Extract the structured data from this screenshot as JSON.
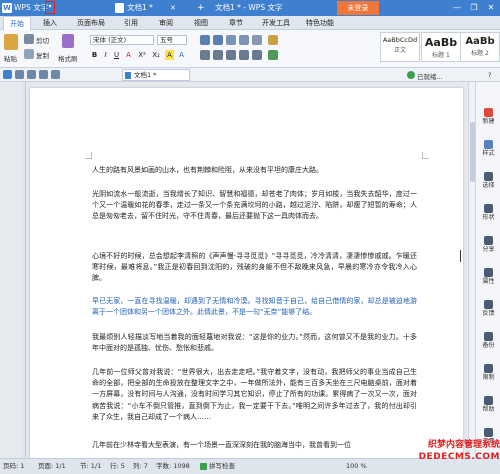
{
  "titlebar": {
    "app_menu": "WPS 文字",
    "dropdown_glyph": "▾",
    "doc_title": "文档1 *",
    "doc_close": "✕",
    "new_tab": "+",
    "app_title": "文档1 * - WPS 文字",
    "login": "未登录",
    "window_controls": [
      "—",
      "❐",
      "✕"
    ]
  },
  "ribbon_tabs": [
    "开始",
    "插入",
    "页面布局",
    "引用",
    "审阅",
    "视图",
    "章节",
    "开发工具",
    "特色功能"
  ],
  "ribbon": {
    "paste": "粘贴",
    "cut": "剪切",
    "copy": "复制",
    "format_painter": "格式刷",
    "font_name": "宋体 (正文)",
    "font_size": "五号",
    "font_buttons": [
      "B",
      "I",
      "U",
      "A",
      "X²",
      "X₂",
      "A",
      "A"
    ],
    "styles": [
      {
        "sample": "AaBbCcDd",
        "name": "正文"
      },
      {
        "sample": "AaBb",
        "name": "标题 1"
      },
      {
        "sample": "AaBb",
        "name": "标题 2"
      }
    ],
    "qa_status": "已就绪...",
    "help_glyph": "?"
  },
  "doc_tab": "文档1 *",
  "document": {
    "paragraphs": [
      {
        "text": "人生的路有风景如画的山水，也有荆棘和险阻，从来没有平坦的康庄大路。",
        "blue": false
      },
      {
        "text": "光阴如流水一般流逝，当我增长了知识、智慧和福德，却苍老了肉体；岁月如梭，当我失去韶华，度过一个又一个温暖如花的春季，走过一条又一个条充满坎坷的小路，越过泥泞、陷阱，却瘦了短暂的寿命；人总是匆匆老去，留不住时光，守不住青春，最后还要抛下这一具肉体而去。",
        "blue": false
      },
      {
        "text": "心境不好的时候，总会想起李清照的《声声慢·寻寻觅觅》“寻寻觅觅，冷冷清清，凄凄惨惨戚戚。乍暖还寒时候，最难将息。”我正是初春回到沈阳的，残破的身躯不但不敌晚来风急，早晨的寒冷亦令我冷入心脾。",
        "blue": false
      },
      {
        "text": "早已无家，一直在寻找温暖，却遇到了无情和冷漠。寻找知音于自己，给自己借情的家，却总是被迫地游离于一个团体和另一个团体之外。此情此景，不是一句“无奈”能够了结。",
        "blue": true
      },
      {
        "text": "我最烦别人轻描淡写地当着我的面轻蔑地对我说：“这是你的业力。”然而，这何曾又不是我的业力。十多年中面对的是孤独、忧伤、愁怅和悲戚。",
        "blue": false
      },
      {
        "text": "几年前一位师父曾对我说：“世界很大，出去走走吧。”我守着文字，没有动，我把师父的事业当成自己生命的全部，把全部的生命投放在整理文字之中，一年做所法外，能有三百多天坐在三尺电脑桌前，面对着一方屏幕，没有时间与人沟通，没有时间学习其它知识，停止了所有的功课。累得病了一次又一次，面对病苦我说：“小车不倒只管推，直到倒下为止，我一定要干下去。”唯明之间许多年过去了，我的付出却引来了众生，我自己却成了一个病人……",
        "blue": false
      },
      {
        "text": "几年前在少林寺看大型表演，有一个场景一直深深刻在我的脑海当中，我曾看到一位",
        "blue": false
      }
    ]
  },
  "sidebar": [
    {
      "icon": "new-icon",
      "label": "新建"
    },
    {
      "icon": "format-icon",
      "label": "样式"
    },
    {
      "icon": "select-icon",
      "label": "选择"
    },
    {
      "icon": "shape-icon",
      "label": "形状"
    },
    {
      "icon": "share-icon",
      "label": "分享"
    },
    {
      "icon": "property-icon",
      "label": "属性"
    },
    {
      "icon": "feedback-icon",
      "label": "反馈"
    },
    {
      "icon": "backup-icon",
      "label": "备份"
    },
    {
      "icon": "restrict-icon",
      "label": "限制"
    },
    {
      "icon": "help-icon",
      "label": "帮助"
    },
    {
      "icon": "tools-icon",
      "label": "工具"
    }
  ],
  "statusbar": {
    "page": "页码: 1",
    "pages": "页面: 1/1",
    "section": "节: 1/1",
    "row": "行: 5",
    "col": "列: 7",
    "words": "字数: 1098",
    "spell": "拼写检查",
    "zoom": "100 %"
  },
  "watermark": {
    "line1": "织梦内容管理系统",
    "line2": "DEDECMS.COM"
  },
  "colors": {
    "titlebar": "#3f7fd0",
    "login": "#f0763a",
    "highlight_border": "#e0221a",
    "blue_text": "#1f5fb8"
  }
}
